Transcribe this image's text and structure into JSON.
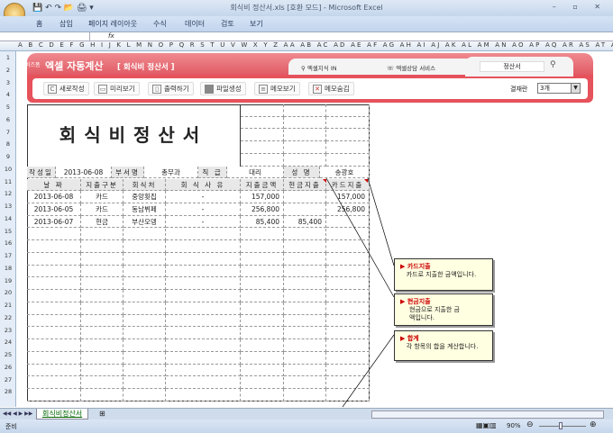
{
  "window": {
    "title": "회식비 정산서.xls [호환 모드] - Microsoft Excel"
  },
  "ribbon_tabs": [
    "홈",
    "삽입",
    "페이지 레이아웃",
    "수식",
    "데이터",
    "검토",
    "보기"
  ],
  "formula": {
    "fx": "fx",
    "value": ""
  },
  "columns": "A B C D E F G H I J K L M N O P Q R S T U V W X Y Z AA AB AC AD AE AF AG AH AI AJ AK AL AM AN AO AP AQ AR AS AT AU AV AW AX AY AZ BB BC BD",
  "rows": [
    "1",
    "2",
    "3",
    "4",
    "5",
    "6",
    "7",
    "8",
    "9",
    "10",
    "11",
    "12",
    "13",
    "14",
    "15",
    "16",
    "17",
    "18",
    "19",
    "20",
    "21",
    "22",
    "23",
    "24",
    "25",
    "26",
    "27",
    "28"
  ],
  "banner": {
    "brand_small": "비즈폼",
    "brand": "엑셀 자동계산",
    "subtitle": "[ 회식비 정산서 ]",
    "link1": "엑셀지식 IN",
    "link2": "엑셀상담 서비스",
    "search_value": "정산서",
    "buttons": [
      "새로작성",
      "미리보기",
      "출력하기",
      "파일생성",
      "메모보기",
      "메모숨김"
    ],
    "approval_label": "결재란",
    "approval_value": "3개"
  },
  "sheet": {
    "title": "회식비정산서",
    "info": {
      "date_label": "작성일",
      "date": "2013-06-08",
      "dept_label": "부서명",
      "dept": "총무과",
      "rank_label": "직 급",
      "rank": "대리",
      "name_label": "성 명",
      "name": "송광호"
    },
    "headers": [
      "날 짜",
      "지출구분",
      "회식처",
      "회 식 사 유",
      "지출금액",
      "현금지출",
      "카드지출"
    ],
    "rows": [
      [
        "2013-06-08",
        "카드",
        "중앙횟집",
        "-",
        "157,000",
        "",
        "157,000"
      ],
      [
        "2013-06-05",
        "카드",
        "동남뷔페",
        "-",
        "256,800",
        "",
        "256,800"
      ],
      [
        "2013-06-07",
        "현금",
        "부산오뎅",
        "-",
        "85,400",
        "85,400",
        ""
      ]
    ]
  },
  "comments": [
    {
      "title": "카드지출",
      "body": "카드로 지출한 금액입니다."
    },
    {
      "title": "현금지출",
      "body": "현금으로 지출한 금액입니다."
    },
    {
      "title": "합계",
      "body": "각 항목의 합을 계산합니다."
    }
  ],
  "sheet_tab": "회식비정산서",
  "status": {
    "ready": "준비",
    "zoom": "90%"
  },
  "colors": {
    "accent": "#e6525b"
  }
}
